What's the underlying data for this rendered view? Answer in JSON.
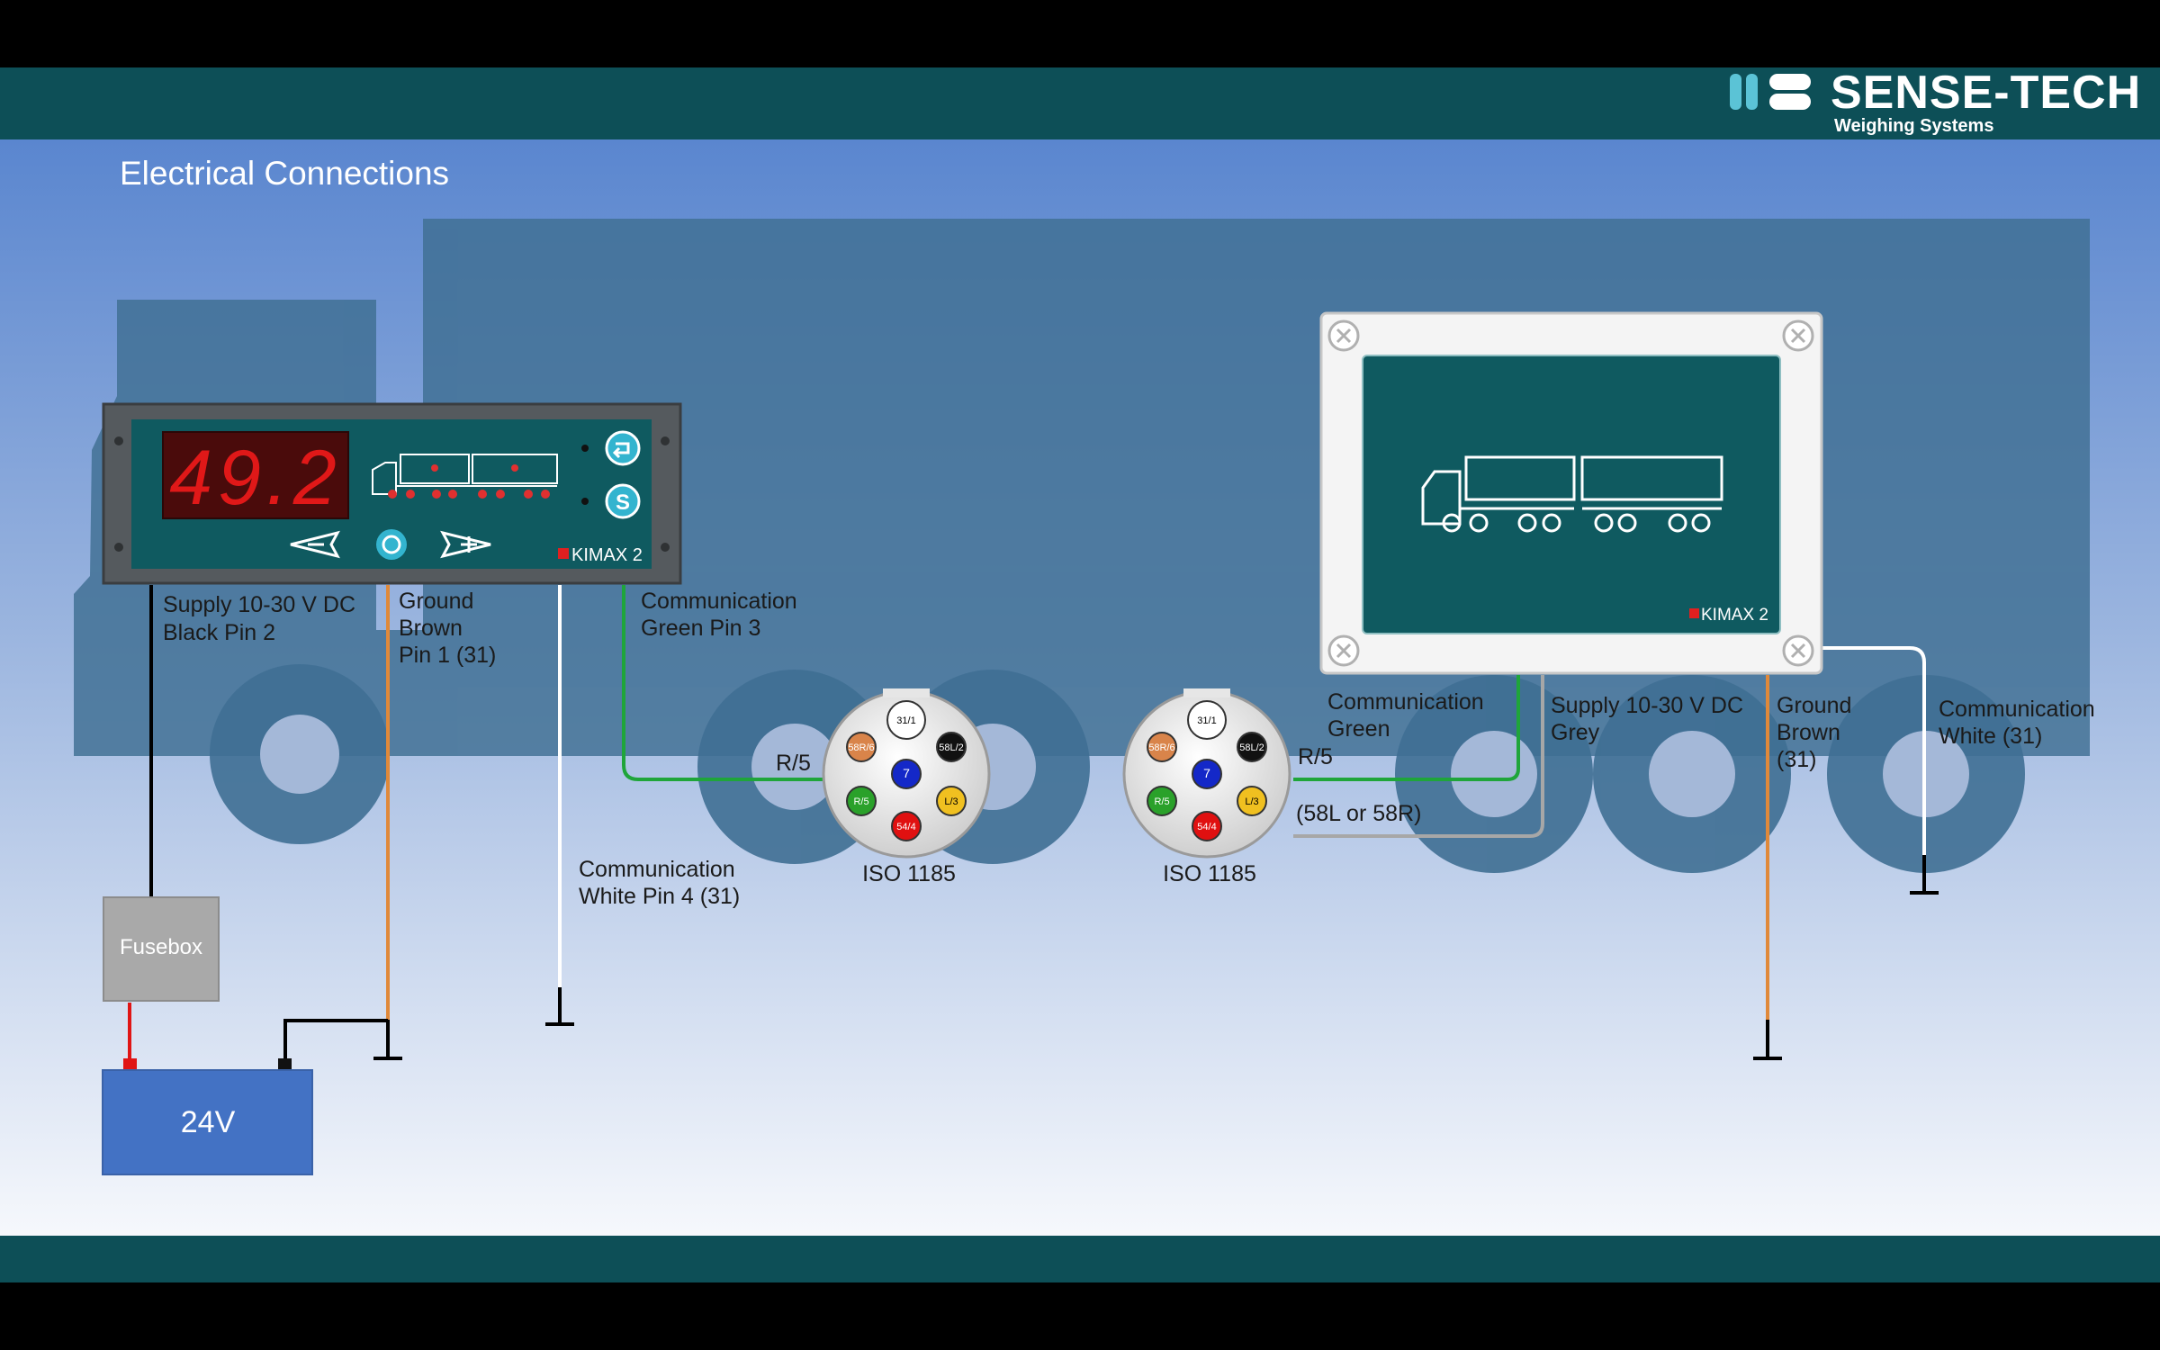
{
  "slide": {
    "title": "Electrical Connections",
    "colors": {
      "header_bar": "#0d4f57",
      "bg_top": "#5a86cf",
      "bg_bottom": "#f4f6fb",
      "truck_silhouette": "#3f6f93",
      "display_panel": "#0f5a60"
    }
  },
  "logo": {
    "name": "SENSE-TECH",
    "tagline": "Weighing Systems",
    "icon": "sense-tech-logo-icon"
  },
  "indicator": {
    "reading": "49.2",
    "brand": "KIMAX 2",
    "buttons": [
      "back-arrow-icon",
      "s-icon",
      "minus-icon",
      "power-icon",
      "plus-icon"
    ]
  },
  "junction_box": {
    "brand": "KIMAX 2",
    "screws": 4
  },
  "labels": {
    "supply_left_1": "Supply 10-30 V DC",
    "supply_left_2": "Black Pin 2",
    "ground_left_1": "Ground",
    "ground_left_2": "Brown",
    "ground_left_3": "Pin 1 (31)",
    "comm_green_left_1": "Communication",
    "comm_green_left_2": "Green Pin 3",
    "comm_white_left_1": "Communication",
    "comm_white_left_2": "White Pin 4 (31)",
    "r5_left": "R/5",
    "r5_right": "R/5",
    "iso_left": "ISO 1185",
    "iso_right": "ISO 1185",
    "comm_green_right_1": "Communication",
    "comm_green_right_2": "Green",
    "supply_right_1": "Supply 10-30 V DC",
    "supply_right_2": "Grey",
    "ground_right_1": "Ground",
    "ground_right_2": "Brown",
    "ground_right_3": "(31)",
    "comm_white_right_1": "Communication",
    "comm_white_right_2": "White (31)",
    "alt_58": "(58L or 58R)",
    "fusebox": "Fusebox",
    "battery": "24V"
  },
  "iso_pins": [
    {
      "label": "31/1",
      "color": "#ffffff",
      "text": "#000000"
    },
    {
      "label": "58R/6",
      "color": "#d9844a",
      "text": "#ffffff"
    },
    {
      "label": "58L/2",
      "color": "#111111",
      "text": "#ffffff"
    },
    {
      "label": "7",
      "color": "#1428c8",
      "text": "#ffffff"
    },
    {
      "label": "R/5",
      "color": "#2aa12a",
      "text": "#ffffff"
    },
    {
      "label": "L/3",
      "color": "#f0c020",
      "text": "#000000"
    },
    {
      "label": "54/4",
      "color": "#e01010",
      "text": "#ffffff"
    }
  ],
  "wire_colors": {
    "black": "#000000",
    "brown": "#e0893a",
    "white": "#ffffff",
    "green": "#1fa53a",
    "grey": "#a7a7a7",
    "red": "#e01515"
  }
}
